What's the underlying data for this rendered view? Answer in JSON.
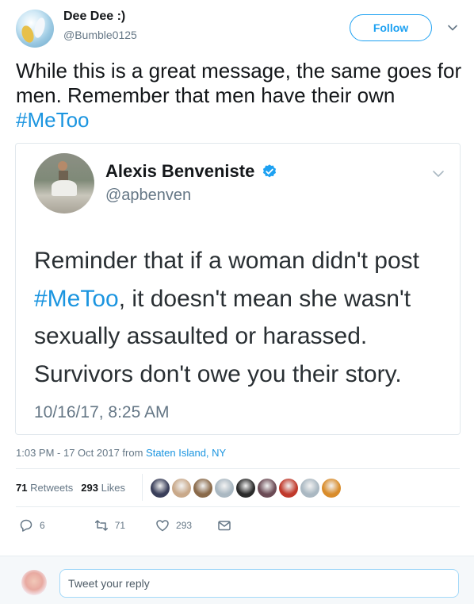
{
  "tweet": {
    "author_name": "Dee Dee :)",
    "author_handle": "@Bumble0125",
    "follow_label": "Follow",
    "text_before": "While this is a great message, the same goes for men.  Remember that men have their own ",
    "hashtag": "#MeToo",
    "timestamp": "1:03 PM - 17 Oct 2017 from ",
    "location": "Staten Island, NY"
  },
  "quoted": {
    "author_name": "Alexis Benveniste",
    "author_handle": "@apbenven",
    "text_line1": "Reminder that if a woman didn't post",
    "hashtag": "#MeToo",
    "text_line2_rest": ", it doesn't mean she wasn't",
    "text_line3": "sexually assaulted or harassed.",
    "text_line4": "Survivors don't owe you their story.",
    "date": "10/16/17, 8:25 AM"
  },
  "stats": {
    "retweets_count": "71",
    "retweets_label": "Retweets",
    "likes_count": "293",
    "likes_label": "Likes"
  },
  "likers": [
    {
      "color": "#3a3f5a"
    },
    {
      "color": "#c9a98a"
    },
    {
      "color": "#8a6a4a"
    },
    {
      "color": "#aab8c2"
    },
    {
      "color": "#2b2b2b"
    },
    {
      "color": "#6b4b55"
    },
    {
      "color": "#c0392b"
    },
    {
      "color": "#aab8c2"
    },
    {
      "color": "#d98c2b"
    }
  ],
  "actions": {
    "reply_count": "6",
    "retweet_count": "71",
    "like_count": "293"
  },
  "reply": {
    "placeholder": "Tweet your reply"
  },
  "colors": {
    "accent": "#1da1f2",
    "link": "#1b95e0",
    "muted": "#657786"
  }
}
